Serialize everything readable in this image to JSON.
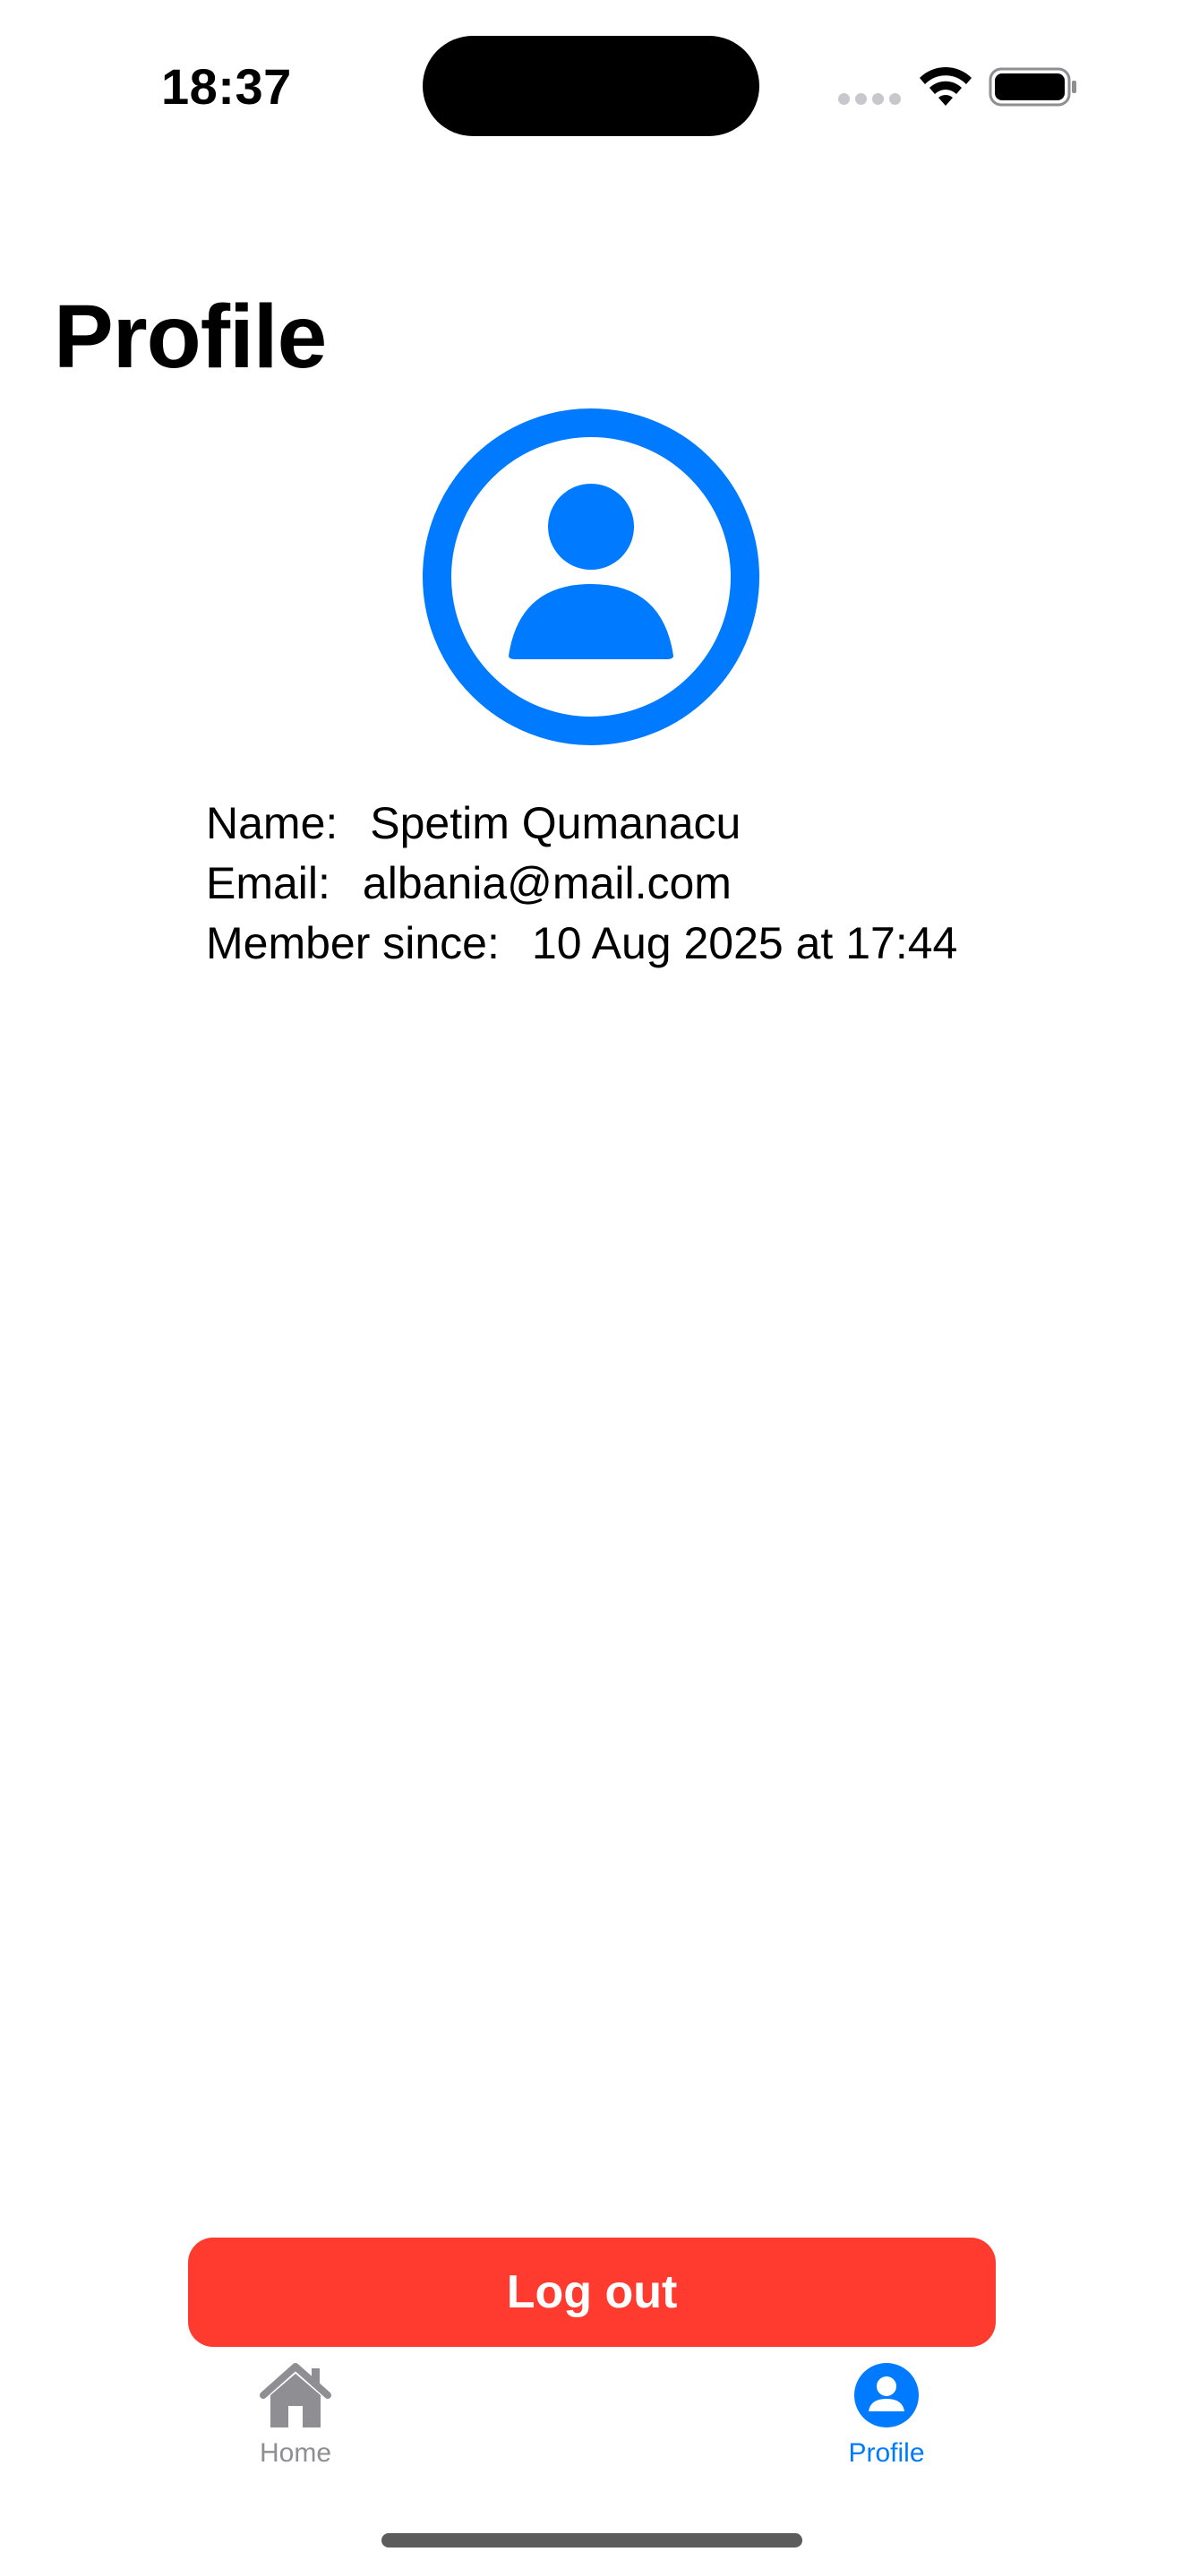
{
  "status_bar": {
    "time": "18:37"
  },
  "header": {
    "title": "Profile"
  },
  "avatar": {
    "icon": "person-circle-icon",
    "color": "#007aff"
  },
  "profile": {
    "name_label": "Name:",
    "name_value": "Spetim Qumanacu",
    "email_label": "Email:",
    "email_value": "albania@mail.com",
    "member_label": "Member since:",
    "member_value": "10 Aug 2025 at 17:44"
  },
  "actions": {
    "logout_label": "Log out",
    "logout_color": "#ff3b30"
  },
  "tab_bar": {
    "tabs": [
      {
        "label": "Home",
        "icon": "house-icon",
        "selected": false
      },
      {
        "label": "Profile",
        "icon": "person-circle-fill-icon",
        "selected": true
      }
    ],
    "active_color": "#007aff",
    "inactive_color": "#8e8e93"
  }
}
